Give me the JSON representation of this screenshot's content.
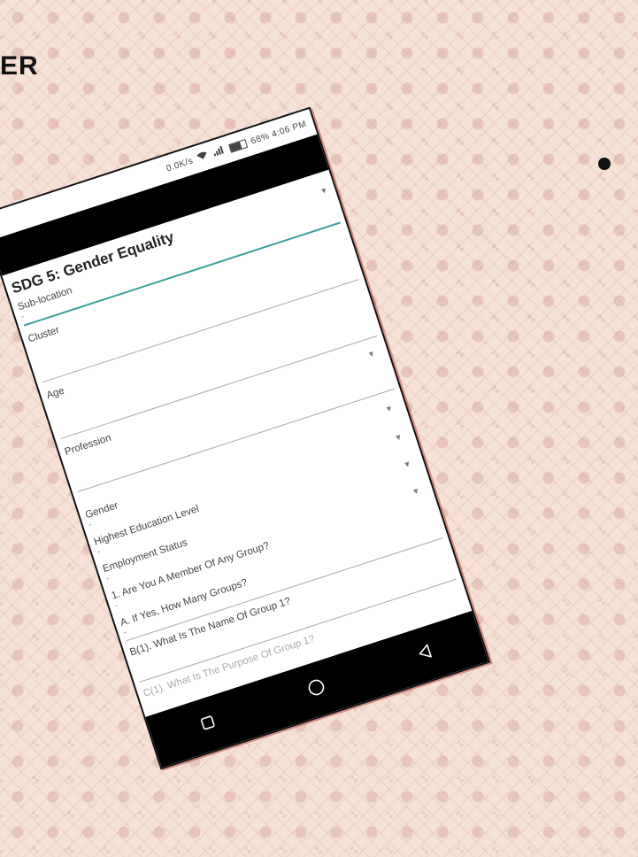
{
  "slide": {
    "title_fragment": "ER"
  },
  "status_bar": {
    "speed": "0.0K/s",
    "battery": "68%",
    "time": "4:06 PM"
  },
  "form": {
    "title": "SDG 5: Gender Equality",
    "fields": [
      {
        "label": "Sub-location",
        "value": "-",
        "type": "select"
      },
      {
        "label": "Cluster",
        "value": "",
        "type": "text"
      },
      {
        "label": "Age",
        "value": "",
        "type": "text"
      },
      {
        "label": "Profession",
        "value": "",
        "type": "select"
      },
      {
        "label": "Gender",
        "value": "-",
        "type": "select"
      },
      {
        "label": "Highest Education Level",
        "value": "-",
        "type": "select"
      },
      {
        "label": "Employment Status",
        "value": "-",
        "type": "select"
      },
      {
        "label": "1. Are You A Member Of Any Group?",
        "value": "-",
        "type": "select"
      },
      {
        "label": "A. If Yes, How Many Groups?",
        "value": "-",
        "type": "text"
      },
      {
        "label": "B(1). What Is The Name Of Group 1?",
        "value": "",
        "type": "text"
      },
      {
        "label": "C(1). What Is The Purpose Of Group 1?",
        "value": "",
        "type": "text"
      }
    ]
  },
  "icons": {
    "dropdown": "chevron-down-icon",
    "nav_back": "back-triangle-icon",
    "nav_home": "home-circle-icon",
    "nav_recent": "recent-square-icon"
  },
  "colors": {
    "accent": "#3d9e98"
  }
}
